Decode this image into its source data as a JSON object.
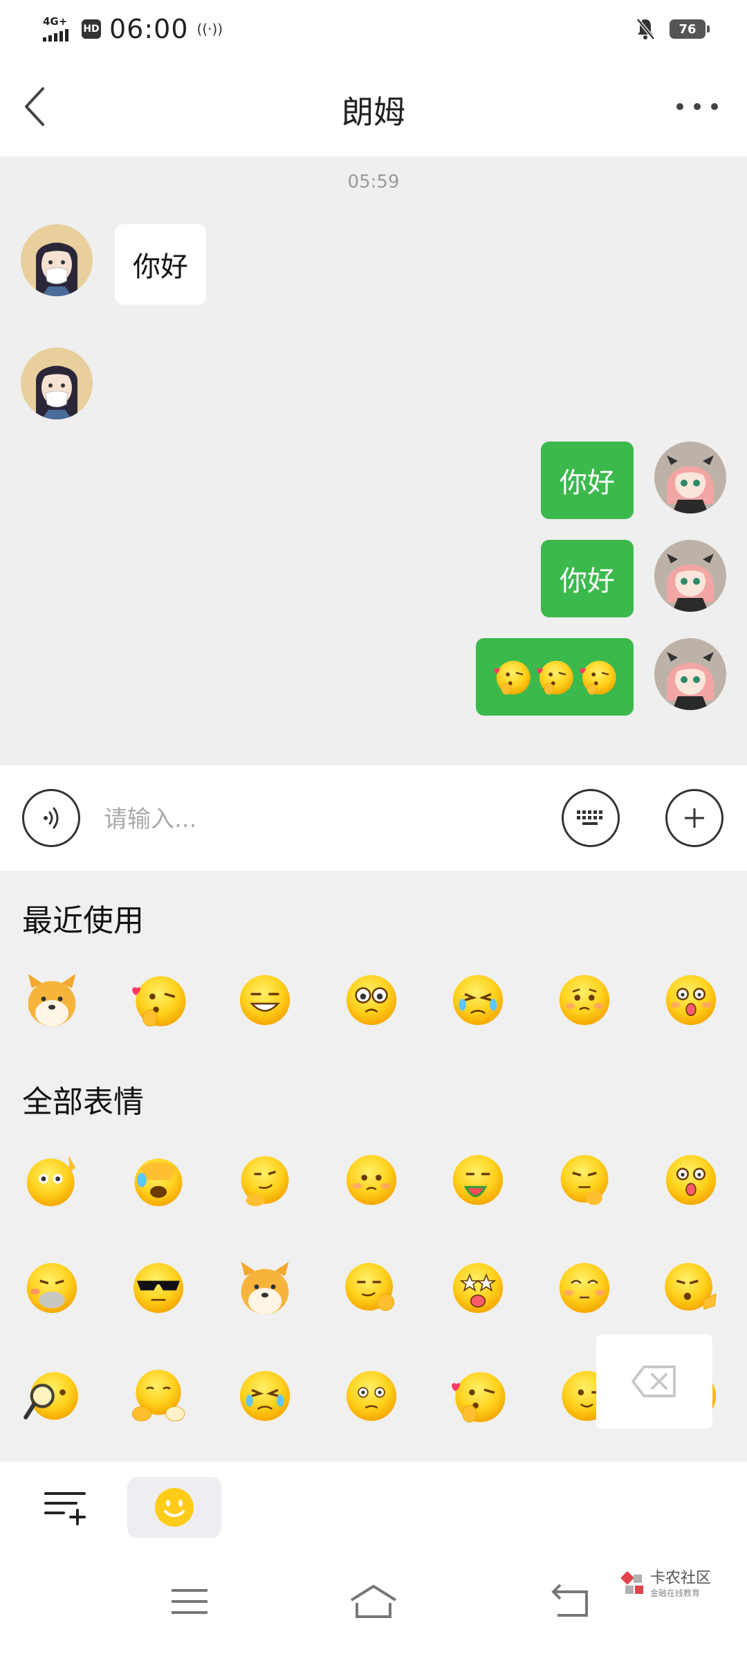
{
  "status_bar": {
    "network": "4G+",
    "hd": "HD",
    "time": "06:00",
    "battery": "76",
    "icons": [
      "signal-icon",
      "hd-icon",
      "hotspot-icon",
      "bell-muted-icon",
      "battery-icon"
    ]
  },
  "header": {
    "title": "朗姆",
    "back_icon": "chevron-left-icon",
    "more_icon": "more-dots-icon"
  },
  "chat": {
    "timestamp": "05:59",
    "messages": [
      {
        "side": "incoming",
        "text": "你好"
      },
      {
        "side": "incoming",
        "text": ""
      },
      {
        "side": "outgoing",
        "text": "你好"
      },
      {
        "side": "outgoing",
        "text": "你好"
      },
      {
        "side": "outgoing",
        "text": "",
        "emojis": [
          "blow-kiss-emoji",
          "blow-kiss-emoji",
          "blow-kiss-emoji"
        ]
      }
    ]
  },
  "input_bar": {
    "placeholder": "请输入...",
    "voice_icon": "voice-icon",
    "keyboard_icon": "keyboard-icon",
    "add_icon": "plus-icon"
  },
  "emoji_panel": {
    "recent_title": "最近使用",
    "all_title": "全部表情",
    "recent": [
      "doge-emoji",
      "blow-kiss-emoji",
      "grin-emoji",
      "teary-eyes-emoji",
      "sob-emoji",
      "worried-emoji",
      "shocked-emoji"
    ],
    "all": [
      "salute-emoji",
      "facepalm-laugh-emoji",
      "smirk-point-emoji",
      "worried-emoji",
      "watermelon-emoji",
      "thinking-emoji",
      "shocked-emoji",
      "blush-mask-emoji",
      "cool-sunglasses-emoji",
      "doge-emoji",
      "okay-hand-emoji",
      "starry-eyes-emoji",
      "eye-roll-emoji",
      "thumbs-emoji",
      "magnifier-emoji",
      "fist-bump-emoji",
      "sob-emoji",
      "confused-emoji",
      "blow-kiss-emoji",
      "wink-emoji",
      "hidden-emoji"
    ],
    "delete_icon": "backspace-icon"
  },
  "toolbar": {
    "list_icon": "list-add-icon",
    "emoji_icon": "smiley-icon"
  },
  "navbar": {
    "menu_icon": "menu-icon",
    "home_icon": "home-icon",
    "back_icon": "back-arrow-icon",
    "watermark_main": "卡农社区",
    "watermark_sub": "金融在线教育"
  },
  "colors": {
    "chat_bg": "#efefef",
    "bubble_out": "#3cb94c",
    "emoji_yellow": "#ffcc1a",
    "panel_bg": "#f0f0f0"
  }
}
